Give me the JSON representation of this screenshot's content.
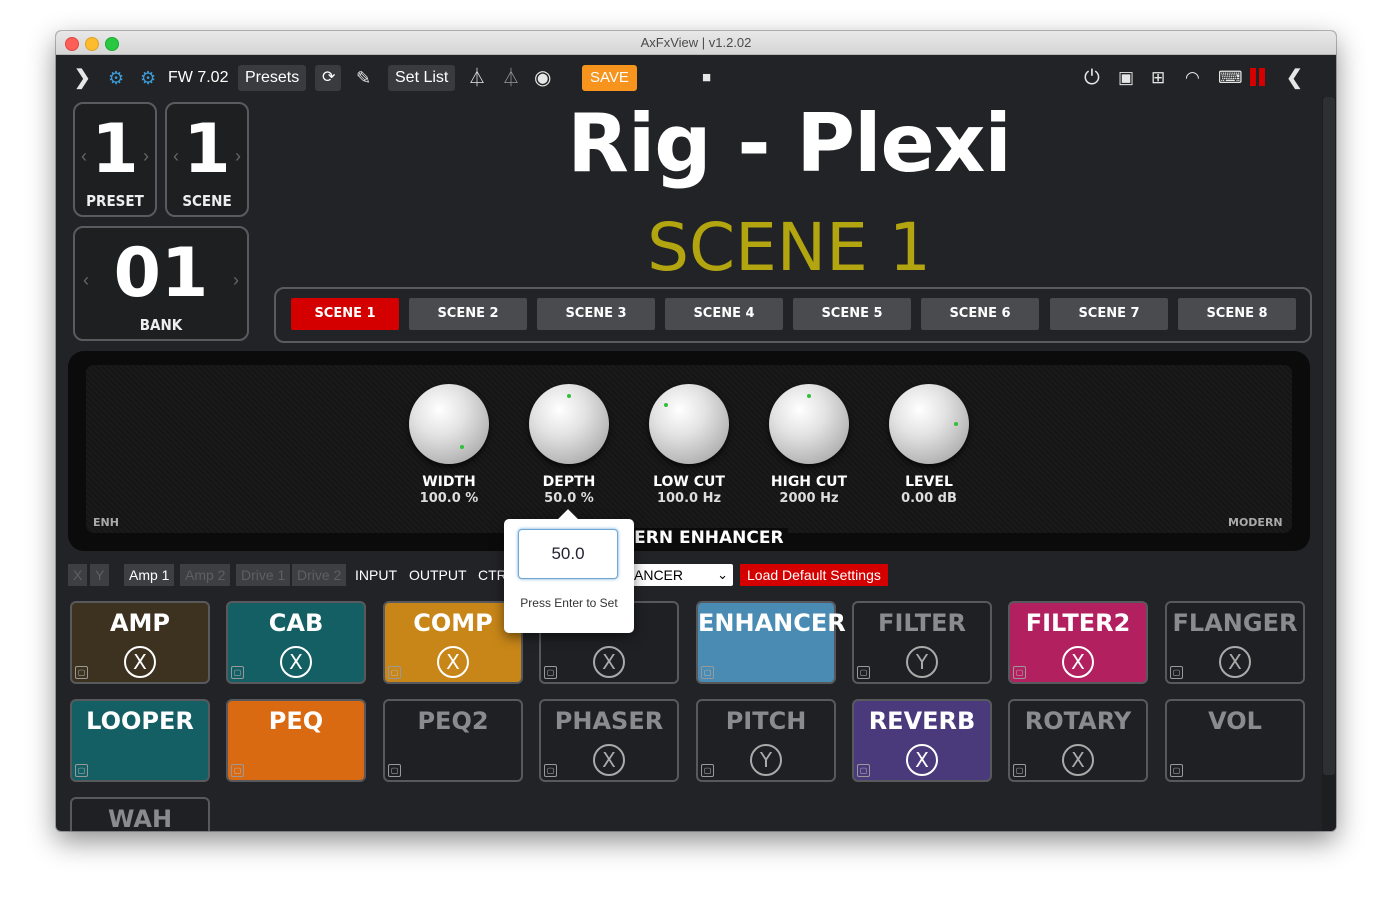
{
  "window": {
    "title": "AxFxView | v1.2.02"
  },
  "toolbar": {
    "expand_glyph": "❯",
    "fw": "FW 7.02",
    "presets": "Presets",
    "refresh_glyph": "⟳",
    "setlist": "Set List",
    "save": "SAVE",
    "collapse_glyph": "❮"
  },
  "counters": {
    "preset": {
      "value": "1",
      "label": "PRESET"
    },
    "scene": {
      "value": "1",
      "label": "SCENE"
    },
    "bank": {
      "value": "01",
      "label": "BANK"
    },
    "left_glyph": "‹",
    "right_glyph": "›"
  },
  "header": {
    "preset_name": "Rig - Plexi",
    "scene_name": "SCENE 1"
  },
  "scenes": [
    "SCENE 1",
    "SCENE 2",
    "SCENE 3",
    "SCENE 4",
    "SCENE 5",
    "SCENE 6",
    "SCENE 7",
    "SCENE 8"
  ],
  "active_scene_index": 0,
  "effect": {
    "left_label": "ENH",
    "right_label": "MODERN",
    "name": "DERN ENHANCER",
    "knobs": [
      {
        "name": "WIDTH",
        "value": "100.0 %"
      },
      {
        "name": "DEPTH",
        "value": "50.0 %"
      },
      {
        "name": "LOW CUT",
        "value": "100.0 Hz"
      },
      {
        "name": "HIGH CUT",
        "value": "2000 Hz"
      },
      {
        "name": "LEVEL",
        "value": "0.00 dB"
      }
    ]
  },
  "tabs": {
    "x": "X",
    "y": "Y",
    "amp1": "Amp 1",
    "amp2": "Amp 2",
    "drive1": "Drive 1",
    "drive2": "Drive 2",
    "input": "INPUT",
    "output": "OUTPUT",
    "ctr": "CTR",
    "type_select": "ANCER",
    "load_default": "Load Default Settings"
  },
  "popover": {
    "value": "50.0",
    "hint": "Press Enter to Set"
  },
  "blocks": [
    {
      "name": "AMP",
      "state": "X",
      "color": "#3d3220"
    },
    {
      "name": "CAB",
      "state": "X",
      "color": "#145f63"
    },
    {
      "name": "COMP",
      "state": "X",
      "color": "#c88618"
    },
    {
      "name": "Y",
      "state": "X",
      "color": "#1f2023"
    },
    {
      "name": "ENHANCER",
      "state": "",
      "color": "#4a8bb3"
    },
    {
      "name": "FILTER",
      "state": "Y",
      "color": "#1f2023"
    },
    {
      "name": "FILTER2",
      "state": "X",
      "color": "#b2205f"
    },
    {
      "name": "FLANGER",
      "state": "X",
      "color": "#1f2023"
    },
    {
      "name": "LOOPER",
      "state": "",
      "color": "#145f63"
    },
    {
      "name": "PEQ",
      "state": "",
      "color": "#d96a12"
    },
    {
      "name": "PEQ2",
      "state": "",
      "color": "#1f2023"
    },
    {
      "name": "PHASER",
      "state": "X",
      "color": "#1f2023"
    },
    {
      "name": "PITCH",
      "state": "Y",
      "color": "#1f2023"
    },
    {
      "name": "REVERB",
      "state": "X",
      "color": "#4a3a7c"
    },
    {
      "name": "ROTARY",
      "state": "X",
      "color": "#1f2023"
    },
    {
      "name": "VOL",
      "state": "",
      "color": "#1f2023"
    },
    {
      "name": "WAH",
      "state": "",
      "color": "#1f2023"
    }
  ]
}
